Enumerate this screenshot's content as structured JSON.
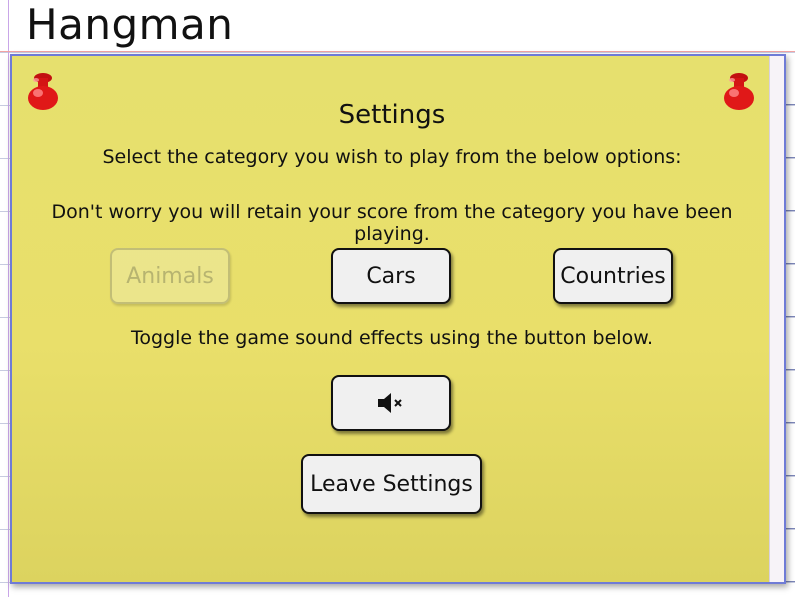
{
  "page": {
    "title": "Hangman"
  },
  "settings": {
    "heading": "Settings",
    "category_prompt": "Select the category you wish to play from the below options:",
    "retain_note": "Don't worry you will retain your score from the category you have been playing.",
    "categories": [
      {
        "label": "Animals",
        "state": "disabled"
      },
      {
        "label": "Cars",
        "state": "enabled"
      },
      {
        "label": "Countries",
        "state": "enabled"
      }
    ],
    "sound_prompt": "Toggle the game sound effects using the button below.",
    "sound_button": {
      "icon": "speaker-muted-icon",
      "state": "muted"
    },
    "leave_label": "Leave Settings"
  },
  "colors": {
    "card_yellow": "#e8df6b",
    "card_border": "#6f7bd6",
    "pin_red": "#e01818",
    "button_bg": "#f0f0f0"
  }
}
